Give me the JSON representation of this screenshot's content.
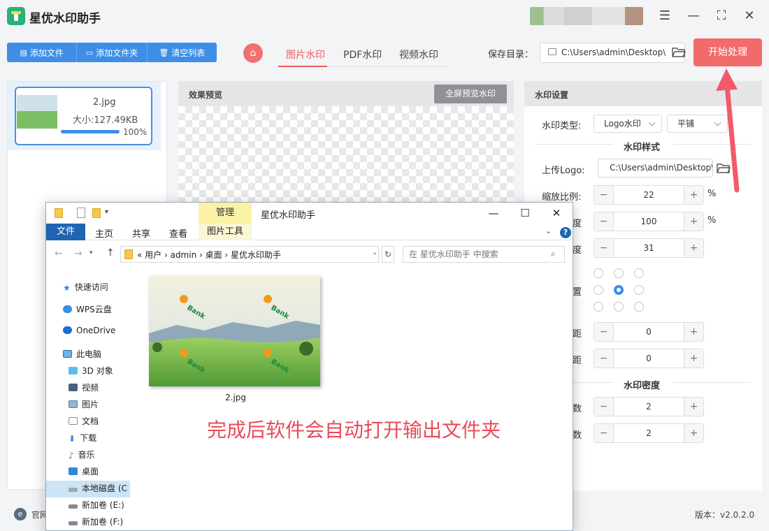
{
  "app": {
    "title": "星优水印助手",
    "version": "版本：v2.0.2.0",
    "site": "官网"
  },
  "toolbar": {
    "add_file": "添加文件",
    "add_folder": "添加文件夹",
    "clear_list": "清空列表",
    "start": "开始处理",
    "save_label": "保存目录：",
    "save_path": "C:\\Users\\admin\\Desktop\\"
  },
  "tabs": [
    {
      "label": "图片水印",
      "active": true
    },
    {
      "label": "PDF水印"
    },
    {
      "label": "视频水印"
    }
  ],
  "file": {
    "name": "2.jpg",
    "size": "大小:127.49KB",
    "progress_pct": 100,
    "progress_text": "100%"
  },
  "preview": {
    "label": "效果预览",
    "fullscreen": "全屏预览水印"
  },
  "settings": {
    "title": "水印设置",
    "type_label": "水印类型:",
    "type_value": "Logo水印",
    "mode_value": "平铺",
    "style_title": "水印样式",
    "logo_label": "上传Logo:",
    "logo_path": "C:\\Users\\admin\\Desktop\\",
    "scale_label": "缩放比例:",
    "scale_value": "22",
    "pct": "%",
    "row2_tail": "度",
    "row2_value": "100",
    "row3_tail": "度",
    "row3_value": "31",
    "pos_tail": "置",
    "row5_tail": "距",
    "row5_value": "0",
    "row6_tail": "距",
    "row6_value": "0",
    "density_title": "水印密度",
    "row7_tail": "数",
    "row7_value": "2",
    "row8_tail": "数",
    "row8_value": "2"
  },
  "explorer": {
    "title": "星优水印助手",
    "manage": "管理",
    "ribbon": {
      "file": "文件",
      "home": "主页",
      "share": "共享",
      "view": "查看",
      "image_tools": "图片工具"
    },
    "address": "«  用户  ›  admin  ›  桌面  ›  星优水印助手",
    "search_placeholder": "在 星优水印助手 中搜索",
    "nav": [
      {
        "label": "快速访问"
      },
      {
        "label": "WPS云盘"
      },
      {
        "label": "OneDrive"
      },
      {
        "label": "此电脑"
      },
      {
        "label": "3D 对象"
      },
      {
        "label": "视频"
      },
      {
        "label": "图片"
      },
      {
        "label": "文档"
      },
      {
        "label": "下载"
      },
      {
        "label": "音乐"
      },
      {
        "label": "桌面"
      },
      {
        "label": "本地磁盘 (C"
      },
      {
        "label": "新加卷 (E:)"
      },
      {
        "label": "新加卷 (F:)"
      }
    ],
    "file_caption": "2.jpg",
    "watermark_text": "Bank"
  },
  "annotation": "完成后软件会自动打开输出文件夹",
  "colors": {
    "accent": "#3e8ee8",
    "start": "#f26b6b",
    "tab_active": "#ef5b5b",
    "note": "#e94a58"
  }
}
